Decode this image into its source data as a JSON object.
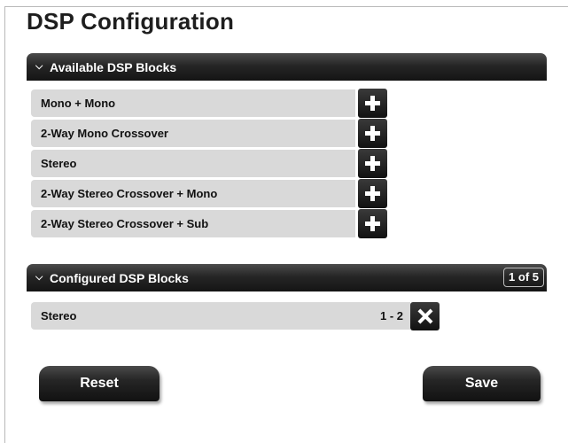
{
  "page": {
    "title": "DSP Configuration"
  },
  "available": {
    "header": "Available DSP Blocks",
    "items": [
      {
        "label": "Mono + Mono"
      },
      {
        "label": "2-Way Mono Crossover"
      },
      {
        "label": "Stereo"
      },
      {
        "label": "2-Way Stereo Crossover + Mono"
      },
      {
        "label": "2-Way Stereo Crossover + Sub"
      }
    ]
  },
  "configured": {
    "header": "Configured DSP Blocks",
    "count": "1 of 5",
    "items": [
      {
        "label": "Stereo",
        "range": "1 - 2"
      }
    ]
  },
  "actions": {
    "reset_label": "Reset",
    "save_label": "Save"
  },
  "icons": {
    "chevron": "chevron-down-icon",
    "add": "plus-icon",
    "remove": "x-icon"
  },
  "colors": {
    "header_bg": "#1a1a1a",
    "row_bg": "#d9d9d9",
    "button_bg": "#222222"
  }
}
